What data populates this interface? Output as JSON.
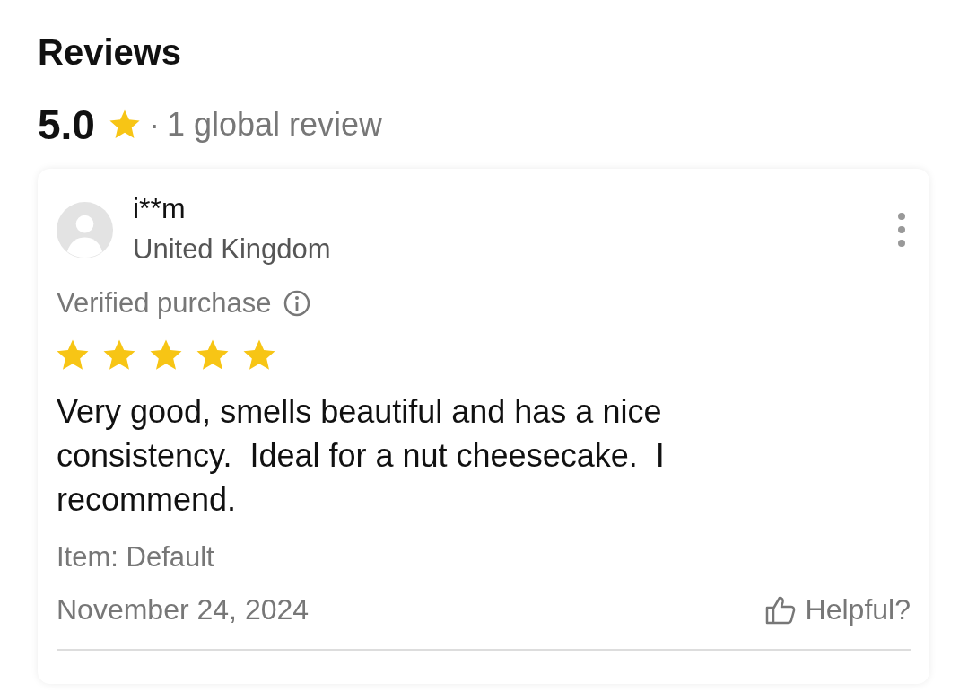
{
  "title": "Reviews",
  "summary": {
    "score": "5.0",
    "separator": "·",
    "count": "1 global review"
  },
  "reviews": [
    {
      "user": "i**m",
      "country": "United Kingdom",
      "verified": "Verified purchase",
      "stars": 5,
      "text": "Very good, smells beautiful and has a nice consistency.  Ideal for a nut cheesecake.  I recommend.",
      "item": "Item: Default",
      "date": "November 24, 2024",
      "helpful": "Helpful?"
    }
  ]
}
